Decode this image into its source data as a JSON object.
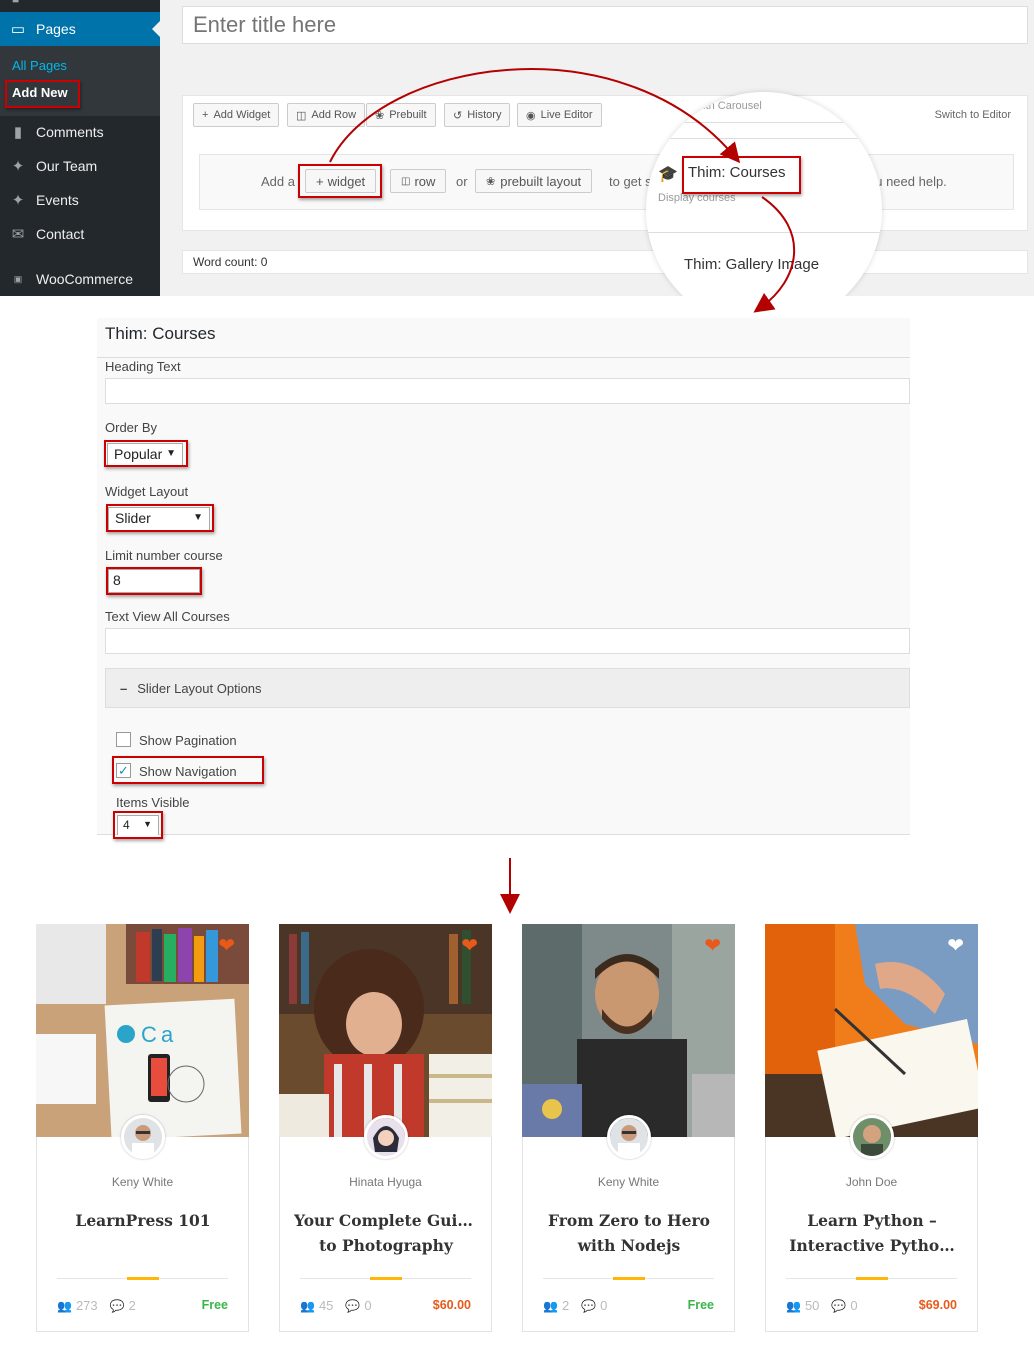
{
  "sidebar": {
    "pages_label": "Pages",
    "submenu": {
      "all_pages": "All Pages",
      "add_new": "Add New"
    },
    "items": [
      {
        "label": "Comments",
        "icon": "comment-icon"
      },
      {
        "label": "Our Team",
        "icon": "pin-icon"
      },
      {
        "label": "Events",
        "icon": "pin-icon"
      },
      {
        "label": "Contact",
        "icon": "envelope-icon"
      },
      {
        "label": "WooCommerce",
        "icon": "woo-icon"
      }
    ]
  },
  "editor": {
    "title_placeholder": "Enter title here",
    "toolbar": {
      "add_widget": "Add Widget",
      "add_row": "Add Row",
      "prebuilt": "Prebuilt",
      "history": "History",
      "live_editor": "Live Editor",
      "switch_to_editor": "Switch to Editor"
    },
    "empty_state": {
      "add_a": "Add a",
      "widget": "widget",
      "row": "row",
      "or": "or",
      "prebuilt_layout": "prebuilt layout",
      "to_get": "to get s",
      "you_need_help": "ou need help."
    },
    "word_count": "Word count: 0"
  },
  "magnifier": {
    "top_text": "...with Carousel",
    "widget_title": "Thim: Courses",
    "widget_desc": "Display courses",
    "next_widget": "Thim: Gallery Image"
  },
  "widget_form": {
    "title": "Thim: Courses",
    "heading_text_label": "Heading Text",
    "order_by_label": "Order By",
    "order_by_value": "Popular",
    "widget_layout_label": "Widget Layout",
    "widget_layout_value": "Slider",
    "limit_label": "Limit number course",
    "limit_value": "8",
    "view_all_label": "Text View All Courses",
    "slider_section": "Slider Layout Options",
    "show_pagination": "Show Pagination",
    "show_navigation": "Show Navigation",
    "items_visible_label": "Items Visible",
    "items_visible_value": "4"
  },
  "courses": [
    {
      "author": "Keny White",
      "title_lines": [
        "LearnPress 101"
      ],
      "students": "273",
      "comments": "2",
      "price": "Free",
      "favorite": true
    },
    {
      "author": "Hinata Hyuga",
      "title_lines": [
        "Your Complete Guide",
        "to Photography"
      ],
      "students": "45",
      "comments": "0",
      "price": "$60.00",
      "favorite": true
    },
    {
      "author": "Keny White",
      "title_lines": [
        "From Zero to Hero",
        "with Nodejs"
      ],
      "students": "2",
      "comments": "0",
      "price": "Free",
      "favorite": true
    },
    {
      "author": "John Doe",
      "title_lines": [
        "Learn Python –",
        "Interactive Pytho…"
      ],
      "students": "50",
      "comments": "0",
      "price": "$69.00",
      "favorite": false
    }
  ],
  "colors": {
    "wp_admin_bar": "#23282d",
    "wp_active": "#0073aa",
    "highlight_red": "#cc0000",
    "accent_yellow": "#ffb606",
    "price_free": "#3bb54a",
    "price_paid": "#e8591a",
    "heart": "#e8591a"
  }
}
